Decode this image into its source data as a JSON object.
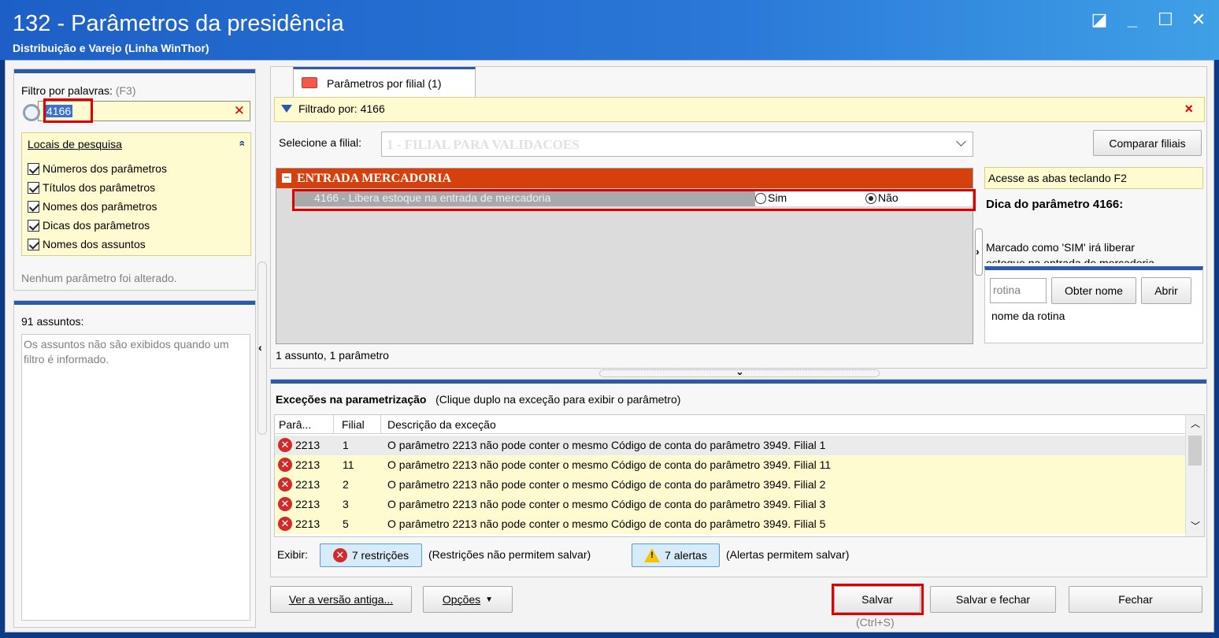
{
  "window": {
    "title": "132 - Parâmetros da presidência",
    "subtitle": "Distribuição e Varejo (Linha WinThor)",
    "controls": [
      "◪",
      "_",
      "☐",
      "✕"
    ]
  },
  "filter": {
    "label": "Filtro por palavras:",
    "shortcut": "(F3)",
    "value": "4166",
    "clear": "✕"
  },
  "search_locations": {
    "title": "Locais de pesquisa",
    "collapse": "»",
    "items": [
      "Números dos parâmetros",
      "Títulos dos parâmetros",
      "Nomes dos parâmetros",
      "Dicas dos parâmetros",
      "Nomes dos assuntos"
    ]
  },
  "no_change_text": "Nenhum parâmetro foi alterado.",
  "subjects": {
    "count_label": "91 assuntos:",
    "empty_text": "Os assuntos não são exibidos quando um filtro é informado."
  },
  "tab": {
    "label": "Parâmetros por filial",
    "count": "(1)"
  },
  "filtered": {
    "text": "Filtrado por: 4166",
    "close": "×"
  },
  "branch": {
    "label": "Selecione a filial:",
    "value": "1 - FILIAL PARA VALIDACOES",
    "compare_button": "Comparar filiais"
  },
  "group": {
    "title": "ENTRADA MERCADORIA",
    "toggle": "−",
    "param_text": "4166 - Libera estoque na entrada de mercadoria",
    "opt_yes": "Sim",
    "opt_no": "Não",
    "selected": "Não"
  },
  "summary": "1 assunto, 1 parâmetro",
  "tip": {
    "hint": "Acesse as abas teclando F2",
    "title": "Dica do parâmetro 4166:",
    "body_line1": "Marcado como 'SIM' irá liberar",
    "body_line2": "estoque na entrada de mercadoria",
    "routine_placeholder": "rotina",
    "get_name_button": "Obter nome",
    "open_button": "Abrir",
    "routine_name_label": "nome da rotina"
  },
  "exceptions": {
    "title": "Exceções na parametrização",
    "hint": "(Clique duplo na exceção para exibir o parâmetro)",
    "columns": [
      "Parâ...",
      "Filial",
      "Descrição da exceção"
    ],
    "rows": [
      {
        "param": "2213",
        "branch": "1",
        "desc": "O parâmetro 2213 não pode conter o mesmo Código de conta do parâmetro 3949. Filial 1"
      },
      {
        "param": "2213",
        "branch": "11",
        "desc": "O parâmetro 2213 não pode conter o mesmo Código de conta do parâmetro 3949. Filial 11"
      },
      {
        "param": "2213",
        "branch": "2",
        "desc": "O parâmetro 2213 não pode conter o mesmo Código de conta do parâmetro 3949. Filial 2"
      },
      {
        "param": "2213",
        "branch": "3",
        "desc": "O parâmetro 2213 não pode conter o mesmo Código de conta do parâmetro 3949. Filial 3"
      },
      {
        "param": "2213",
        "branch": "5",
        "desc": "O parâmetro 2213 não pode conter o mesmo Código de conta do parâmetro 3949. Filial 5"
      }
    ],
    "show_label": "Exibir:",
    "restrictions_button": "7 restrições",
    "restrictions_note": "(Restrições não permitem salvar)",
    "alerts_button": "7 alertas",
    "alerts_note": "(Alertas permitem salvar)"
  },
  "footer": {
    "old_version_button": "Ver a versão antiga...",
    "options_button": "Opções",
    "save_button": "Salvar",
    "save_shortcut": "(Ctrl+S)",
    "save_close_button": "Salvar e fechar",
    "close_button": "Fechar"
  },
  "colors": {
    "group_header": "#d6400d",
    "highlight_box": "#e00000",
    "row_yellow": "#fffbd0",
    "title_blue": "#1d5fc6"
  }
}
